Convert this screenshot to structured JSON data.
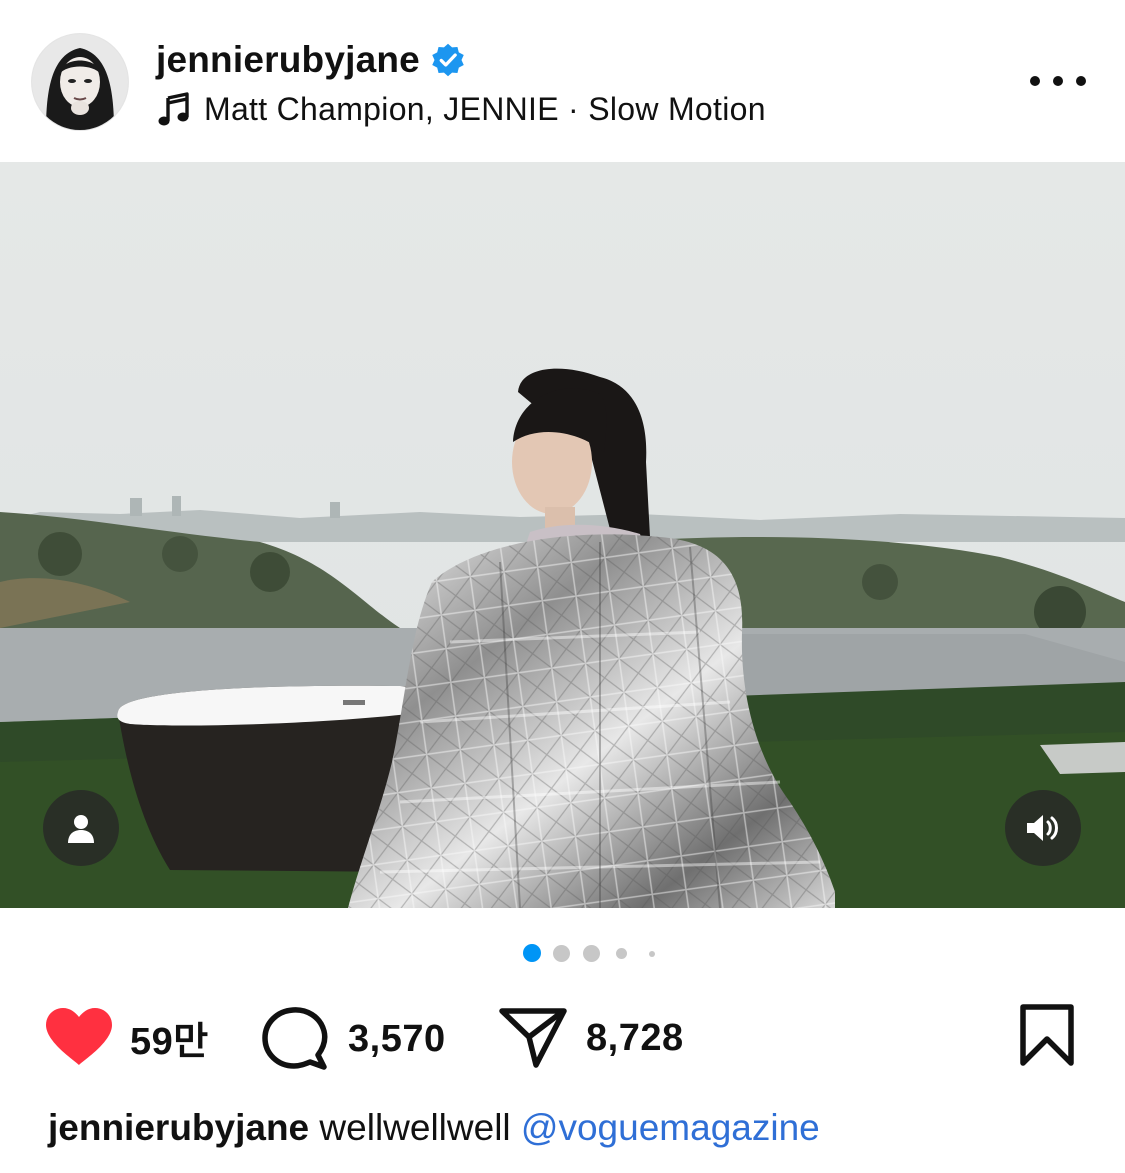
{
  "header": {
    "username": "jennierubyjane",
    "verified": true,
    "audio": "Matt Champion, JENNIE · Slow Motion",
    "avatar_icon": "profile-photo",
    "more_icon": "more-horizontal-icon"
  },
  "media": {
    "user_tags_icon": "person-icon",
    "mute_icon": "speaker-icon",
    "carousel": {
      "total": 5,
      "active": 1
    }
  },
  "actions": {
    "like_count": "59만",
    "comment_count": "3,570",
    "share_count": "8,728",
    "like_color": "#ff3040"
  },
  "caption": {
    "username": "jennierubyjane",
    "text": "wellwellwell",
    "mention": "@voguemagazine",
    "mention_color": "#2f6fd6"
  }
}
